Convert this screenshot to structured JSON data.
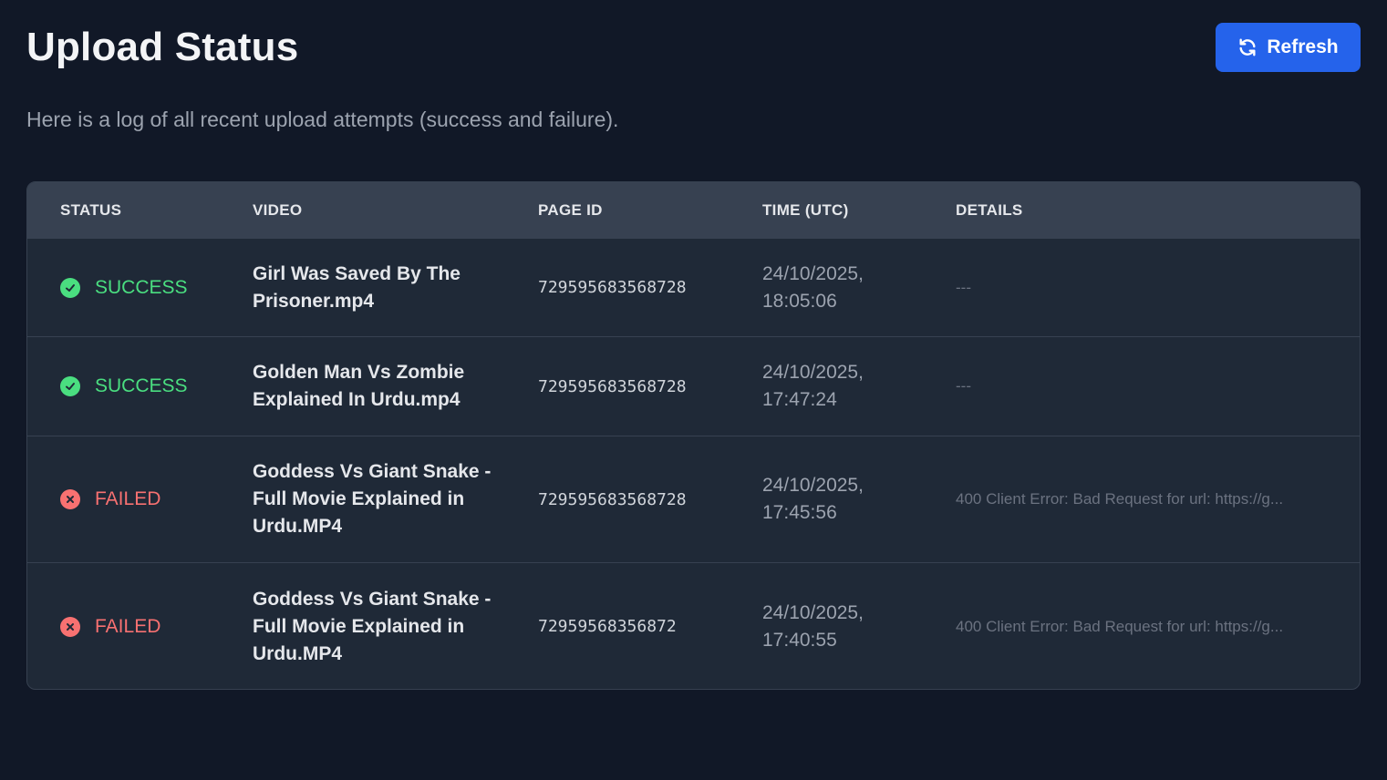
{
  "header": {
    "title": "Upload Status",
    "refresh_label": "Refresh",
    "refresh_icon": "refresh-icon"
  },
  "subtitle": "Here is a log of all recent upload attempts (success and failure).",
  "colors": {
    "background": "#111827",
    "accent": "#2563eb",
    "success": "#4ade80",
    "failed": "#f87171"
  },
  "table": {
    "columns": [
      "STATUS",
      "VIDEO",
      "PAGE ID",
      "TIME (UTC)",
      "DETAILS"
    ],
    "rows": [
      {
        "status": "SUCCESS",
        "status_kind": "success",
        "video": "Girl Was Saved By The Prisoner.mp4",
        "page_id": "729595683568728",
        "time": "24/10/2025, 18:05:06",
        "details": "---"
      },
      {
        "status": "SUCCESS",
        "status_kind": "success",
        "video": "Golden Man Vs Zombie Explained In Urdu.mp4",
        "page_id": "729595683568728",
        "time": "24/10/2025, 17:47:24",
        "details": "---"
      },
      {
        "status": "FAILED",
        "status_kind": "failed",
        "video": "Goddess Vs Giant Snake - Full Movie Explained in Urdu.MP4",
        "page_id": "729595683568728",
        "time": "24/10/2025, 17:45:56",
        "details": "400 Client Error: Bad Request for url: https://g..."
      },
      {
        "status": "FAILED",
        "status_kind": "failed",
        "video": "Goddess Vs Giant Snake - Full Movie Explained in Urdu.MP4",
        "page_id": "72959568356872",
        "time": "24/10/2025, 17:40:55",
        "details": "400 Client Error: Bad Request for url: https://g..."
      }
    ]
  }
}
